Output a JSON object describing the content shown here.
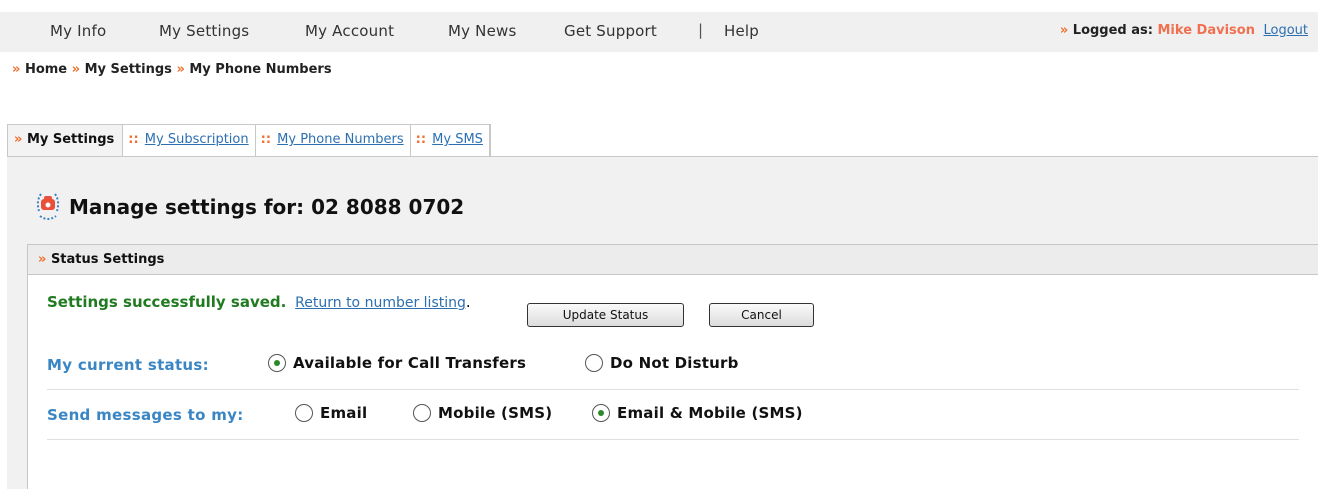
{
  "topnav": {
    "items": [
      "My Info",
      "My Settings",
      "My Account",
      "My News",
      "Get Support",
      "Help"
    ],
    "separator": "|",
    "logged_prefix": "»",
    "logged_label": "Logged as:",
    "user_name": "Mike Davison",
    "logout_label": "Logout"
  },
  "breadcrumb": {
    "marker": "»",
    "items": [
      "Home",
      "My Settings",
      "My Phone Numbers"
    ]
  },
  "tabs": {
    "active_marker": "»",
    "inactive_marker": "::",
    "items": [
      "My Settings",
      "My Subscription",
      "My Phone Numbers",
      "My SMS"
    ]
  },
  "page": {
    "title": "Manage settings for: 02 8088 0702",
    "icon": "phone-icon"
  },
  "status_box": {
    "marker": "»",
    "header": "Status Settings",
    "success_message": "Settings successfully saved.",
    "return_link": "Return to number listing",
    "return_suffix": "."
  },
  "status_row": {
    "label": "My current status:",
    "options": [
      {
        "label": "Available for Call Transfers",
        "checked": true
      },
      {
        "label": "Do Not Disturb",
        "checked": false
      }
    ]
  },
  "messages_row": {
    "label": "Send messages to my:",
    "options": [
      {
        "label": "Email",
        "checked": false
      },
      {
        "label": "Mobile (SMS)",
        "checked": false
      },
      {
        "label": "Email & Mobile (SMS)",
        "checked": true
      }
    ]
  },
  "buttons": {
    "update": "Update Status",
    "cancel": "Cancel"
  },
  "colors": {
    "accent_orange": "#f07030",
    "link_blue": "#2c6fb0",
    "label_blue": "#3a86c4",
    "success_green": "#207a20"
  }
}
